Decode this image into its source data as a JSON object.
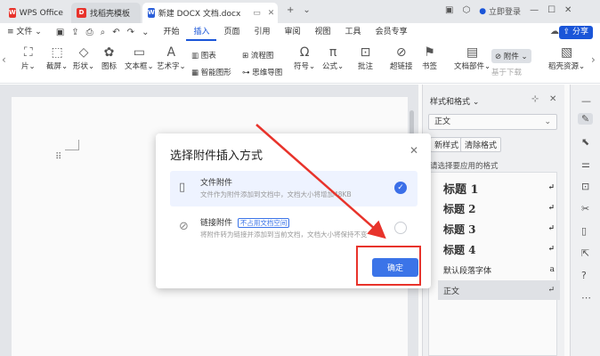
{
  "titlebar": {
    "tabs": [
      "WPS Office",
      "找稻壳模板",
      "新建 DOCX 文档.docx"
    ],
    "login": "立即登录",
    "new_tab": "+"
  },
  "menubar": {
    "file": "文件",
    "items": [
      "开始",
      "插入",
      "页面",
      "引用",
      "审阅",
      "视图",
      "工具",
      "会员专享"
    ],
    "active": "插入",
    "share": "分享"
  },
  "ribbon": {
    "big": [
      "片",
      "截屏",
      "形状",
      "图标",
      "文本框",
      "艺术字",
      "符号",
      "公式",
      "批注",
      "超链接",
      "书签",
      "文档部件",
      "稻壳资源"
    ],
    "small": [
      "图表",
      "流程图",
      "智能图形",
      "思维导图",
      "附件",
      "基于下载"
    ]
  },
  "panel": {
    "title": "样式和格式",
    "current": "正文",
    "btn_new": "新样式",
    "btn_clear": "清除格式",
    "hint": "请选择要应用的格式",
    "styles": [
      "标题 1",
      "标题 2",
      "标题 3",
      "标题 4",
      "默认段落字体",
      "正文"
    ]
  },
  "dialog": {
    "title": "选择附件插入方式",
    "opt1_title": "文件附件",
    "opt1_desc": "文件作为附件添加到文档中，文档大小将增加48KB",
    "opt2_title": "链接附件",
    "opt2_badge": "不占用文档空间",
    "opt2_desc": "将附件转为链接并添加到当前文档，文档大小将保持不变",
    "ok": "确定"
  },
  "colors": {
    "accent": "#1a55d8",
    "highlight": "#e8332b"
  }
}
